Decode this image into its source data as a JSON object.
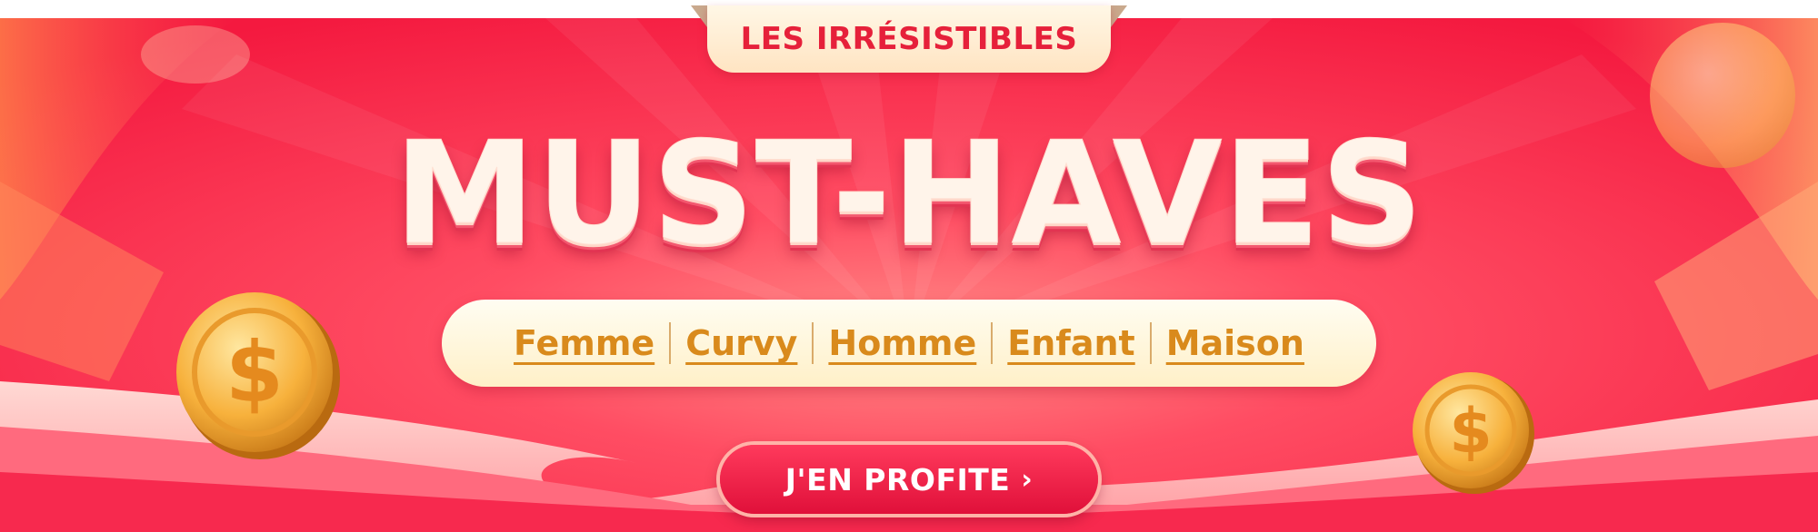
{
  "banner": {
    "eyebrow": "LES IRRÉSISTIBLES",
    "headline": "MUST-HAVES",
    "categories": [
      "Femme",
      "Curvy",
      "Homme",
      "Enfant",
      "Maison"
    ],
    "cta_label": "J'EN PROFITE",
    "cta_chevron": "›",
    "coin_symbol": "$"
  },
  "colors": {
    "background": "#f72c50",
    "eyebrow_text": "#e6203a",
    "headline_text": "#fff4ea",
    "category_text": "#d98a1c",
    "cta_background": "#e0103a",
    "coin_gold": "#f7b13c"
  },
  "icons": {
    "coin": "dollar-coin-icon",
    "chevron": "chevron-right-icon"
  }
}
